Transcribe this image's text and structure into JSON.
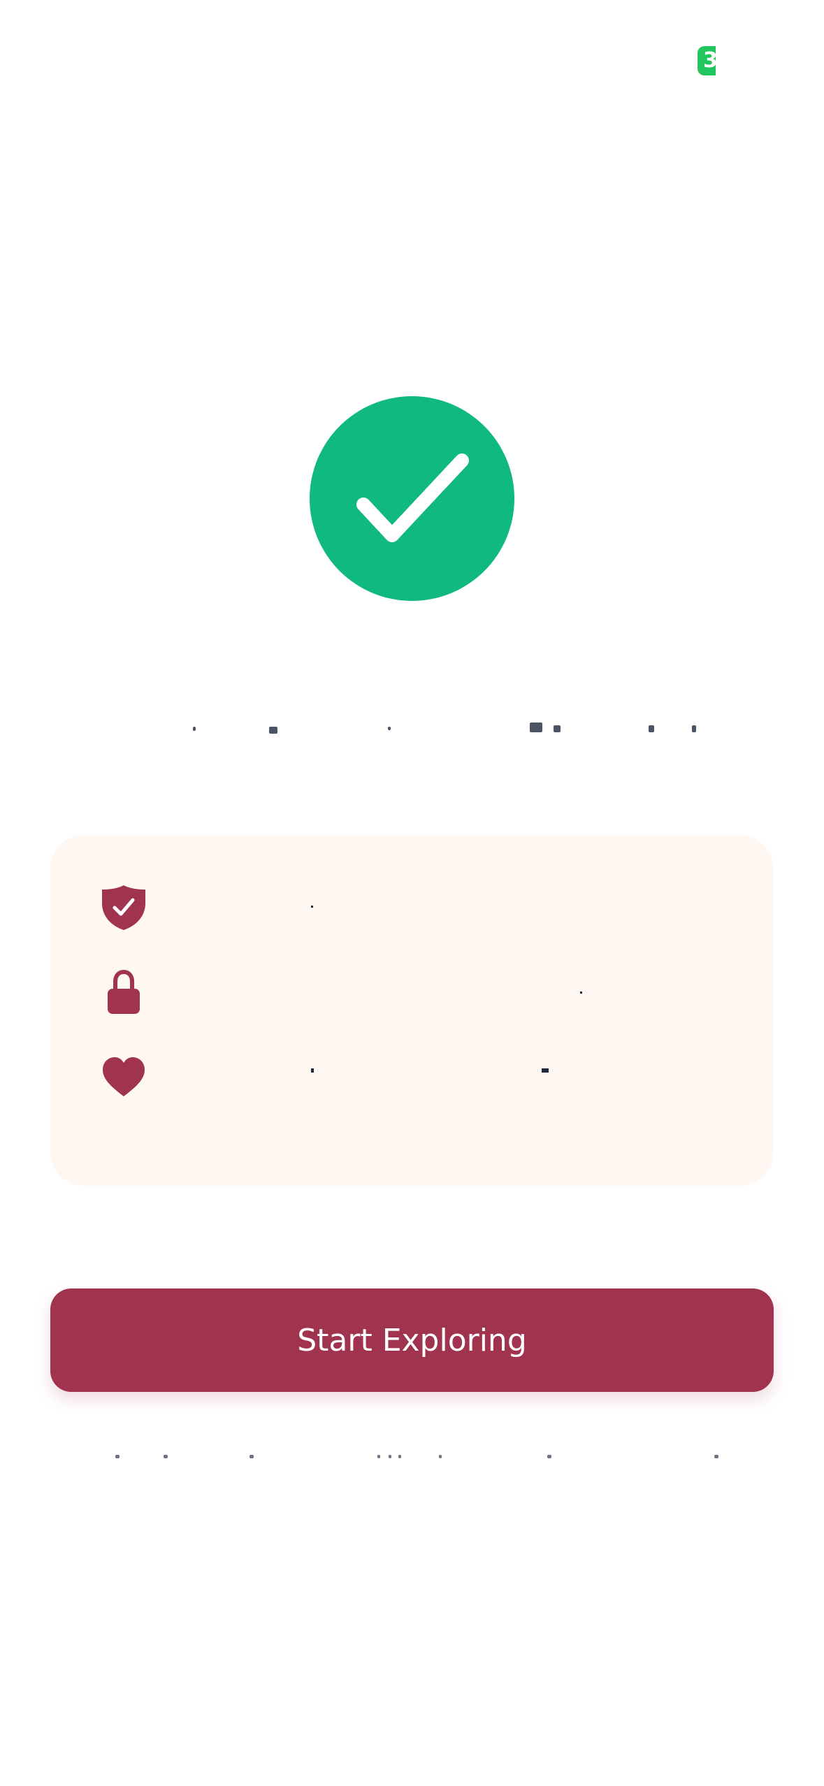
{
  "status": {
    "badge_text": "3",
    "color": "#22c55e"
  },
  "hero": {
    "icon": "checkmark-icon",
    "color": "#10b981"
  },
  "features": {
    "items": [
      {
        "icon": "shield-check-icon"
      },
      {
        "icon": "lock-icon"
      },
      {
        "icon": "heart-icon"
      }
    ],
    "accent": "#a0344f",
    "background": "#fff7f1"
  },
  "cta": {
    "label": "Start Exploring",
    "color": "#a0344f"
  }
}
